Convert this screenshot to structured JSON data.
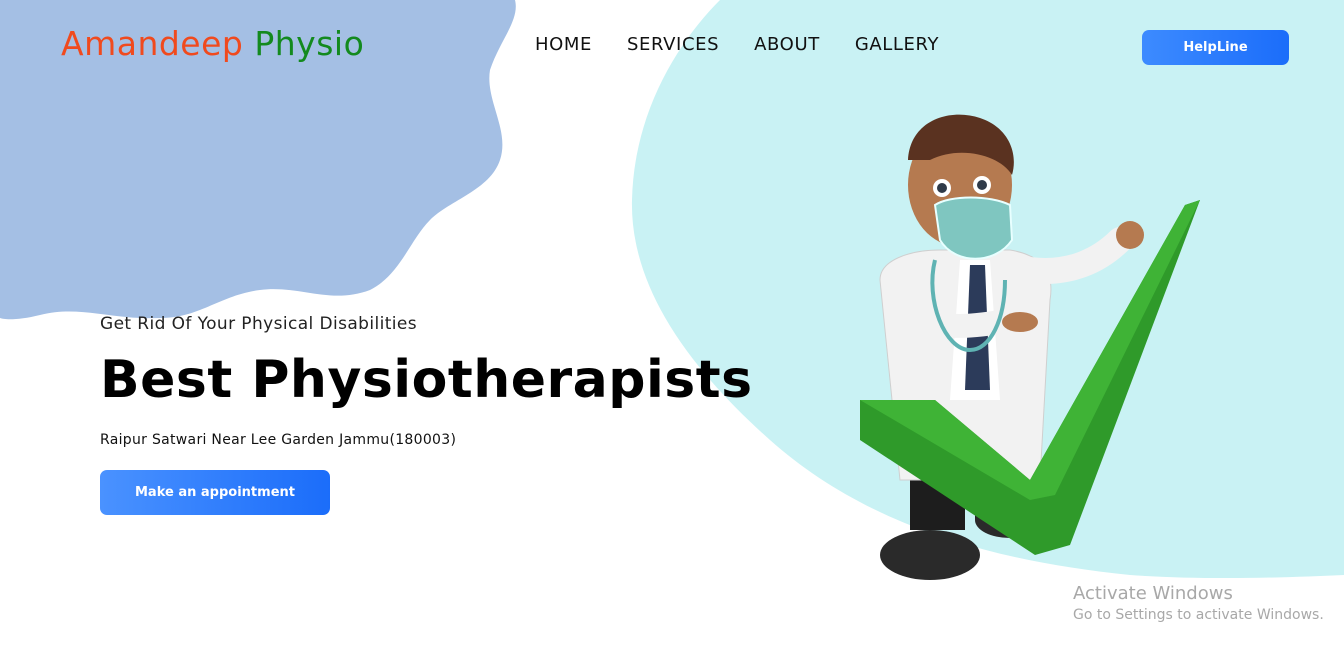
{
  "brand": {
    "name_part1": "Amandeep",
    "name_part2": "Physio"
  },
  "nav": {
    "items": [
      {
        "label": "HOME"
      },
      {
        "label": "SERVICES"
      },
      {
        "label": "ABOUT"
      },
      {
        "label": "GALLERY"
      }
    ]
  },
  "header": {
    "helpline_label": "HelpLine"
  },
  "hero": {
    "tagline": "Get Rid Of Your Physical Disabilities",
    "headline": "Best Physiotherapists",
    "address": "Raipur Satwari Near Lee Garden Jammu(180003)",
    "cta_label": "Make an appointment"
  },
  "watermark": {
    "title": "Activate Windows",
    "subtitle": "Go to Settings to activate Windows."
  },
  "colors": {
    "brand_orange": "#f04a1e",
    "brand_green": "#138a1e",
    "blob_blue": "#a4bfe4",
    "circle_cyan": "#c9f2f4",
    "button_blue": "#1b6dfa",
    "check_green": "#2f9a2a"
  },
  "icons": {
    "illustration": "doctor-with-checkmark-illustration"
  }
}
